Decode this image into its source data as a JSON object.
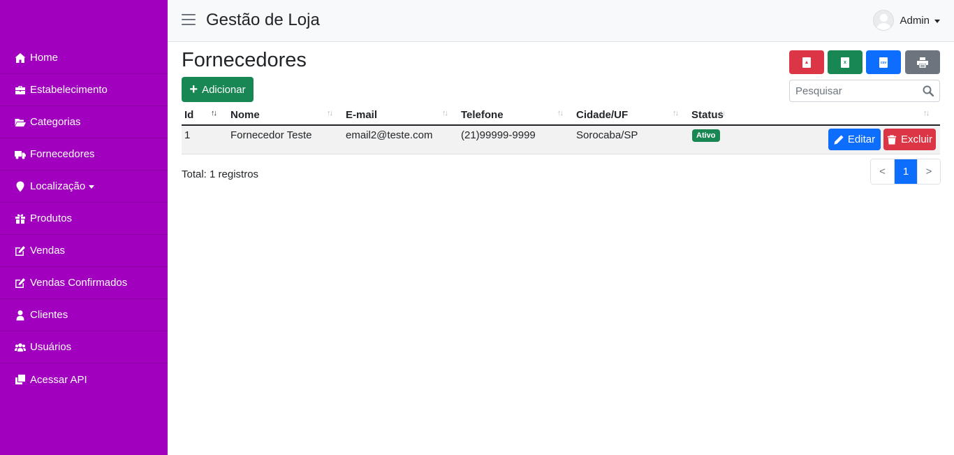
{
  "app": {
    "title": "Gestão de Loja",
    "user": "Admin"
  },
  "sidebar": {
    "items": [
      {
        "label": "Home",
        "icon": "home-icon"
      },
      {
        "label": "Estabelecimento",
        "icon": "briefcase-icon"
      },
      {
        "label": "Categorias",
        "icon": "folder-open-icon"
      },
      {
        "label": "Fornecedores",
        "icon": "truck-icon"
      },
      {
        "label": "Localização",
        "icon": "map-marker-icon"
      },
      {
        "label": "Produtos",
        "icon": "gift-icon"
      },
      {
        "label": "Vendas",
        "icon": "edit-icon"
      },
      {
        "label": "Vendas Confirmados",
        "icon": "edit-icon"
      },
      {
        "label": "Clientes",
        "icon": "user-icon"
      },
      {
        "label": "Usuários",
        "icon": "users-icon"
      },
      {
        "label": "Acessar API",
        "icon": "copy-icon"
      }
    ]
  },
  "page": {
    "title": "Fornecedores",
    "add_label": "Adicionar",
    "search_placeholder": "Pesquisar",
    "export": {
      "pdf": "pdf-export-icon",
      "xls": "excel-export-icon",
      "csv": "csv-export-icon",
      "print": "print-icon"
    }
  },
  "table": {
    "columns": [
      "Id",
      "Nome",
      "E-mail",
      "Telefone",
      "Cidade/UF",
      "Status"
    ],
    "rows": [
      {
        "id": "1",
        "nome": "Fornecedor Teste",
        "email": "email2@teste.com",
        "telefone": "(21)99999-9999",
        "cidade": "Sorocaba/SP",
        "status": "Ativo",
        "edit_label": "Editar",
        "delete_label": "Excluir"
      }
    ],
    "total_text": "Total: 1 registros"
  },
  "pagination": {
    "prev": "<",
    "current": "1",
    "next": ">"
  },
  "colors": {
    "sidebar": "#a100bf",
    "success": "#198754",
    "danger": "#dc3545",
    "primary": "#0d6efd",
    "secondary": "#6c757d"
  }
}
